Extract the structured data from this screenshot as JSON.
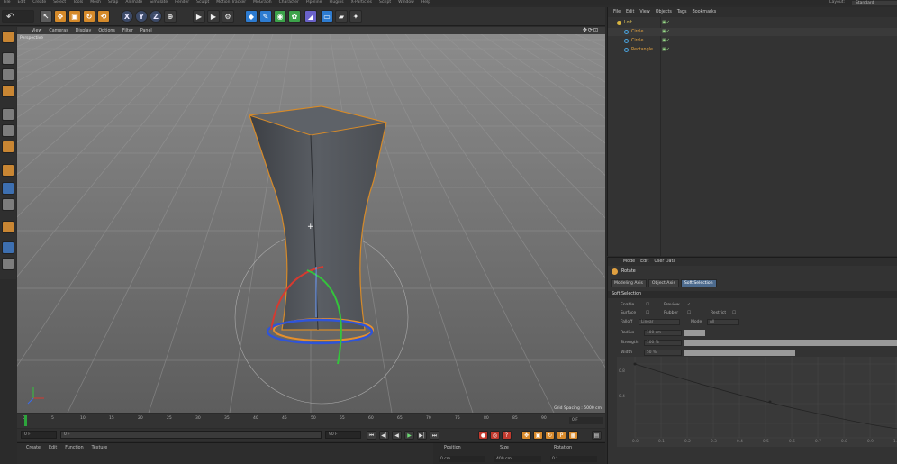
{
  "app": {
    "menu": [
      "File",
      "Edit",
      "Create",
      "Select",
      "Tools",
      "Mesh",
      "Snap",
      "Animate",
      "Simulate",
      "Render",
      "Sculpt",
      "Motion Tracker",
      "MoGraph",
      "Character",
      "Pipeline",
      "Plugins",
      "X-Particles",
      "Script",
      "Window",
      "Help"
    ],
    "layout_label": "Layout:",
    "layout_value": "Standard"
  },
  "toolbar": {
    "undo_icon": "undo-icon",
    "tools": [
      {
        "name": "live-selection-tool",
        "glyph": "↖",
        "style": "sel"
      },
      {
        "name": "move-tool",
        "glyph": "✥",
        "style": "orange"
      },
      {
        "name": "scale-tool",
        "glyph": "▣",
        "style": "orange"
      },
      {
        "name": "rotate-tool",
        "glyph": "↻",
        "style": "orange"
      },
      {
        "name": "recent-tool",
        "glyph": "⟲",
        "style": "orange"
      },
      {
        "name": "x-axis-lock",
        "glyph": "X",
        "style": "axis"
      },
      {
        "name": "y-axis-lock",
        "glyph": "Y",
        "style": "axis"
      },
      {
        "name": "z-axis-lock",
        "glyph": "Z",
        "style": "axis"
      },
      {
        "name": "coordinate-system",
        "glyph": "⊕",
        "style": ""
      },
      {
        "name": "render-view",
        "glyph": "▶",
        "style": ""
      },
      {
        "name": "render-picture-viewer",
        "glyph": "▶",
        "style": ""
      },
      {
        "name": "render-settings",
        "glyph": "⚙",
        "style": ""
      },
      {
        "name": "cube-object",
        "glyph": "◆",
        "style": "blue"
      },
      {
        "name": "pen-spline",
        "glyph": "✎",
        "style": "blue"
      },
      {
        "name": "subdivision-surface",
        "glyph": "◉",
        "style": "green"
      },
      {
        "name": "array-generator",
        "glyph": "✿",
        "style": "green"
      },
      {
        "name": "bend-deformer",
        "glyph": "◢",
        "style": "purple"
      },
      {
        "name": "floor-object",
        "glyph": "▭",
        "style": "blue"
      },
      {
        "name": "camera-object",
        "glyph": "▰",
        "style": ""
      },
      {
        "name": "light-object",
        "glyph": "✦",
        "style": ""
      }
    ]
  },
  "viewport": {
    "menu": [
      "View",
      "Cameras",
      "Display",
      "Options",
      "Filter",
      "Panel"
    ],
    "camera_label": "Perspective",
    "grid_spacing": "Grid Spacing : 5000 cm",
    "nav_icons": "✥⟳⊡"
  },
  "timeline": {
    "ticks": [
      "0",
      "5",
      "10",
      "15",
      "20",
      "25",
      "30",
      "35",
      "40",
      "45",
      "50",
      "55",
      "60",
      "65",
      "70",
      "75",
      "80",
      "85",
      "90"
    ],
    "end_frame": "0 F"
  },
  "transport": {
    "current_frame": "0 F",
    "start_frame": "0 F",
    "end_frame": "90 F",
    "buttons": [
      "⏮",
      "◀|",
      "◀",
      "▶",
      "▶|",
      "⏭"
    ]
  },
  "material_bar": {
    "menu": [
      "Create",
      "Edit",
      "Function",
      "Texture"
    ],
    "coord_headers": [
      "Position",
      "Size",
      "Rotation"
    ],
    "coord_values": [
      "0 cm",
      "400 cm",
      "0 °"
    ]
  },
  "object_manager": {
    "menu": [
      "File",
      "Edit",
      "View",
      "Objects",
      "Tags",
      "Bookmarks"
    ],
    "objects": [
      {
        "name": "Loft",
        "type": "root"
      },
      {
        "name": "Circle",
        "type": "child"
      },
      {
        "name": "Circle",
        "type": "child"
      },
      {
        "name": "Rectangle",
        "type": "child"
      }
    ]
  },
  "attribute_manager": {
    "menu": [
      "Mode",
      "Edit",
      "User Data"
    ],
    "tool_name": "Rotate",
    "tabs": [
      "Modeling Axis",
      "Object Axis",
      "Soft Selection"
    ],
    "active_tab": 2,
    "section": "Soft Selection",
    "params": {
      "enable": "Enable",
      "preview": "Preview",
      "surface": "Surface",
      "rubber": "Rubber",
      "restrict": "Restrict",
      "falloff": "Falloff",
      "falloff_value": "Linear",
      "mode": "Mode",
      "mode_value": "All",
      "radius": "Radius",
      "radius_value": "100 cm",
      "strength": "Strength",
      "strength_value": "100 %",
      "width": "Width",
      "width_value": "50 %"
    },
    "graph_y": [
      "0.8",
      "0.4"
    ],
    "graph_x": [
      "0.0",
      "0.1",
      "0.2",
      "0.3",
      "0.4",
      "0.5",
      "0.6",
      "0.7",
      "0.8",
      "0.9",
      "1.0"
    ]
  }
}
